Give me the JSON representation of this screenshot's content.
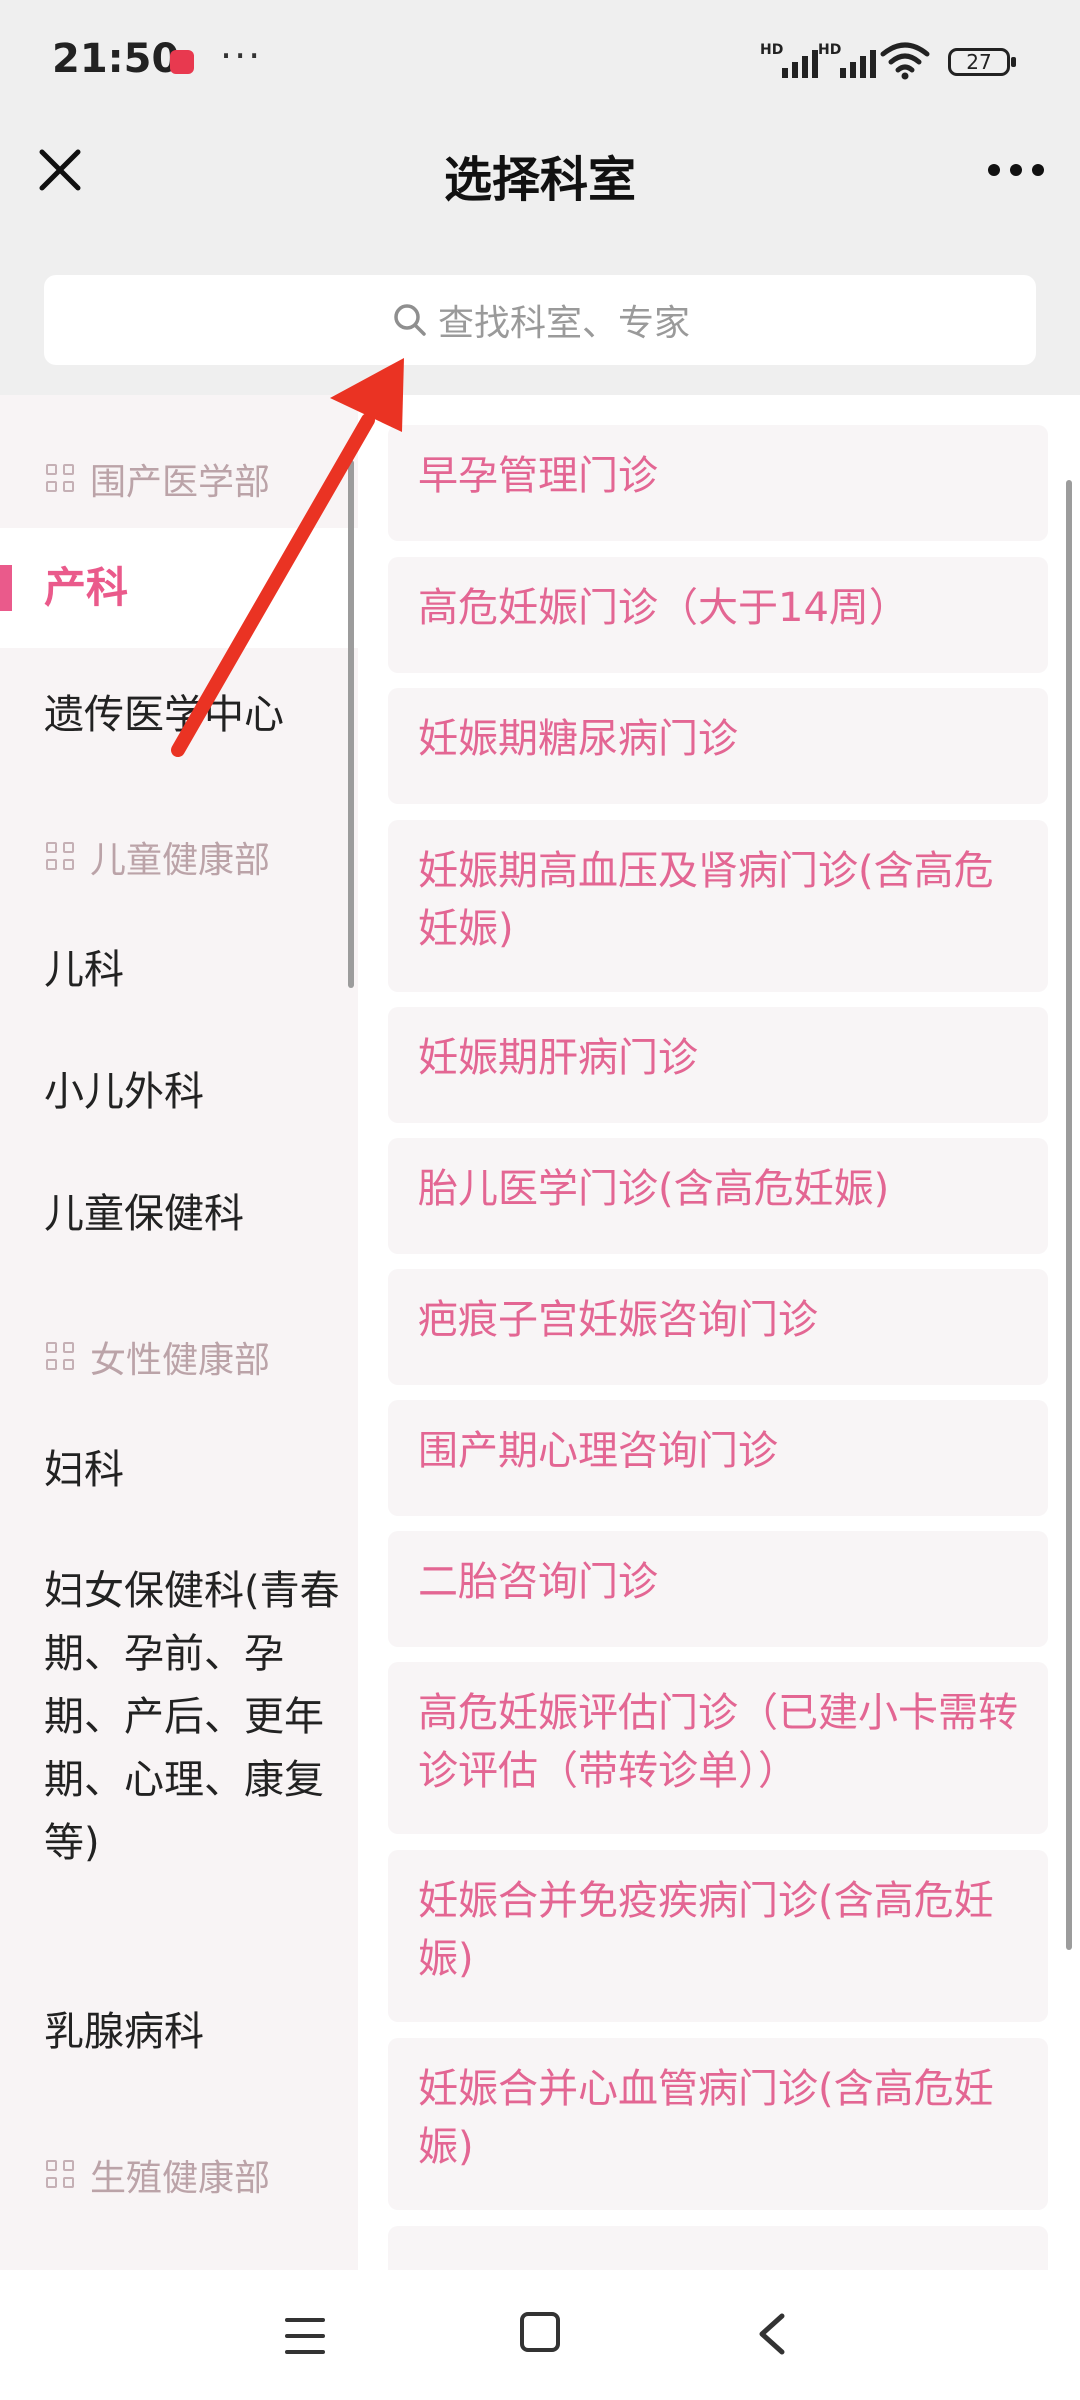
{
  "status_bar": {
    "time": "21:50",
    "dots": "···",
    "battery": "27",
    "hd1": "HD",
    "hd2": "HD"
  },
  "header": {
    "title": "选择科室"
  },
  "search": {
    "placeholder": "查找科室、专家"
  },
  "sidebar": {
    "groups": [
      {
        "header": "围产医学部",
        "items": [
          "产科",
          "遗传医学中心"
        ]
      },
      {
        "header": "儿童健康部",
        "items": [
          "儿科",
          "小儿外科",
          "儿童保健科"
        ]
      },
      {
        "header": "女性健康部",
        "items": [
          "妇科",
          "妇女保健科(青春期、孕前、孕期、产后、更年期、心理、康复等)",
          "乳腺病科"
        ]
      },
      {
        "header": "生殖健康部",
        "items": []
      }
    ],
    "active": "产科"
  },
  "clinics": [
    "早孕管理门诊",
    "高危妊娠门诊（大于14周）",
    "妊娠期糖尿病门诊",
    "妊娠期高血压及肾病门诊(含高危妊娠)",
    "妊娠期肝病门诊",
    "胎儿医学门诊(含高危妊娠)",
    "疤痕子宫妊娠咨询门诊",
    "围产期心理咨询门诊",
    "二胎咨询门诊",
    "高危妊娠评估门诊（已建小卡需转诊评估（带转诊单））",
    "妊娠合并免疫疾病门诊(含高危妊娠)",
    "妊娠合并心血管病门诊(含高危妊娠)"
  ],
  "colors": {
    "accent": "#ea5a8b",
    "clinic_text": "#e36693",
    "arrow": "#ea3323"
  }
}
